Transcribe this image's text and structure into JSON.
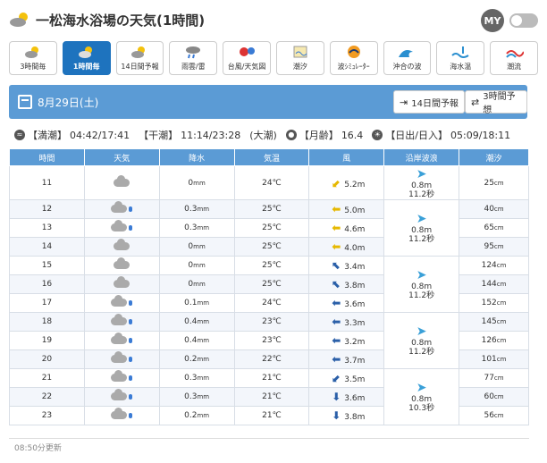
{
  "header": {
    "title": "一松海水浴場の天気(1時間)",
    "my_label": "MY"
  },
  "tabs": [
    {
      "label": "3時間毎",
      "icon": "sun-cloud-icon"
    },
    {
      "label": "1時間毎",
      "icon": "sun-cloud-icon",
      "active": true
    },
    {
      "label": "14日間予報",
      "icon": "sun-cloud-icon"
    },
    {
      "label": "雨雲/雷",
      "icon": "rain-cloud-icon"
    },
    {
      "label": "台風/天気図",
      "icon": "typhoon-icon"
    },
    {
      "label": "潮汐",
      "icon": "tide-icon"
    },
    {
      "label": "波ｼﾐｭﾚｰﾀｰ",
      "icon": "wave-sim-icon"
    },
    {
      "label": "沖合の波",
      "icon": "offshore-wave-icon"
    },
    {
      "label": "海水温",
      "icon": "sea-temp-icon"
    },
    {
      "label": "潮流",
      "icon": "current-icon"
    }
  ],
  "datebar": {
    "date": "8月29日(土)",
    "btn14_label": "14日間予報",
    "btn3_label": "3時間予想"
  },
  "tide": {
    "high_label": "【満潮】",
    "high_value": "04:42/17:41",
    "low_label": "【干潮】",
    "low_value": "11:14/23:28",
    "tide_type": "(大潮)",
    "moon_label": "【月齢】",
    "moon_value": "16.4",
    "sun_label": "【日出/日入】",
    "sun_value": "05:09/18:11"
  },
  "table": {
    "headers": [
      "時間",
      "天気",
      "降水",
      "気温",
      "風",
      "沿岸波浪",
      "潮汐"
    ],
    "precip_unit": "mm",
    "tide_unit": "cm",
    "rows": [
      {
        "hour": "11",
        "weather": "cloud",
        "precip": "0",
        "temp": "24℃",
        "wind_dir": "yellow-ne",
        "wind": "5.2m",
        "tide": "25"
      },
      {
        "hour": "12",
        "weather": "rain",
        "precip": "0.3",
        "temp": "25℃",
        "wind_dir": "yellow-e",
        "wind": "5.0m",
        "tide": "40"
      },
      {
        "hour": "13",
        "weather": "rain",
        "precip": "0.3",
        "temp": "25℃",
        "wind_dir": "yellow-e",
        "wind": "4.6m",
        "tide": "65"
      },
      {
        "hour": "14",
        "weather": "cloud",
        "precip": "0",
        "temp": "25℃",
        "wind_dir": "yellow-e",
        "wind": "4.0m",
        "tide": "95"
      },
      {
        "hour": "15",
        "weather": "cloud",
        "precip": "0",
        "temp": "25℃",
        "wind_dir": "blue-nw",
        "wind": "3.4m",
        "tide": "124"
      },
      {
        "hour": "16",
        "weather": "cloud",
        "precip": "0",
        "temp": "25℃",
        "wind_dir": "blue-nw",
        "wind": "3.8m",
        "tide": "144"
      },
      {
        "hour": "17",
        "weather": "rain",
        "precip": "0.1",
        "temp": "24℃",
        "wind_dir": "blue-w",
        "wind": "3.6m",
        "tide": "152"
      },
      {
        "hour": "18",
        "weather": "rain",
        "precip": "0.4",
        "temp": "23℃",
        "wind_dir": "blue-w",
        "wind": "3.3m",
        "tide": "145"
      },
      {
        "hour": "19",
        "weather": "rain",
        "precip": "0.4",
        "temp": "23℃",
        "wind_dir": "blue-w",
        "wind": "3.2m",
        "tide": "126"
      },
      {
        "hour": "20",
        "weather": "rain",
        "precip": "0.2",
        "temp": "22℃",
        "wind_dir": "blue-w",
        "wind": "3.7m",
        "tide": "101"
      },
      {
        "hour": "21",
        "weather": "rain",
        "precip": "0.3",
        "temp": "21℃",
        "wind_dir": "blue-sw",
        "wind": "3.5m",
        "tide": "77"
      },
      {
        "hour": "22",
        "weather": "rain",
        "precip": "0.3",
        "temp": "21℃",
        "wind_dir": "blue-s",
        "wind": "3.6m",
        "tide": "60"
      },
      {
        "hour": "23",
        "weather": "rain",
        "precip": "0.2",
        "temp": "21℃",
        "wind_dir": "blue-s",
        "wind": "3.8m",
        "tide": "56"
      }
    ],
    "waves": [
      {
        "height": "0.8m",
        "period": "11.2秒"
      },
      {
        "height": "0.8m",
        "period": "11.2秒"
      },
      {
        "height": "0.8m",
        "period": "11.2秒"
      },
      {
        "height": "0.8m",
        "period": "11.2秒"
      },
      {
        "height": "0.8m",
        "period": "10.3秒"
      }
    ]
  },
  "footer": {
    "updated": "08:50分更新"
  },
  "colors": {
    "accent": "#1e73be",
    "header_bg": "#5b9bd5",
    "wind_yellow": "#e6b800",
    "wind_blue": "#2a5fa8"
  }
}
